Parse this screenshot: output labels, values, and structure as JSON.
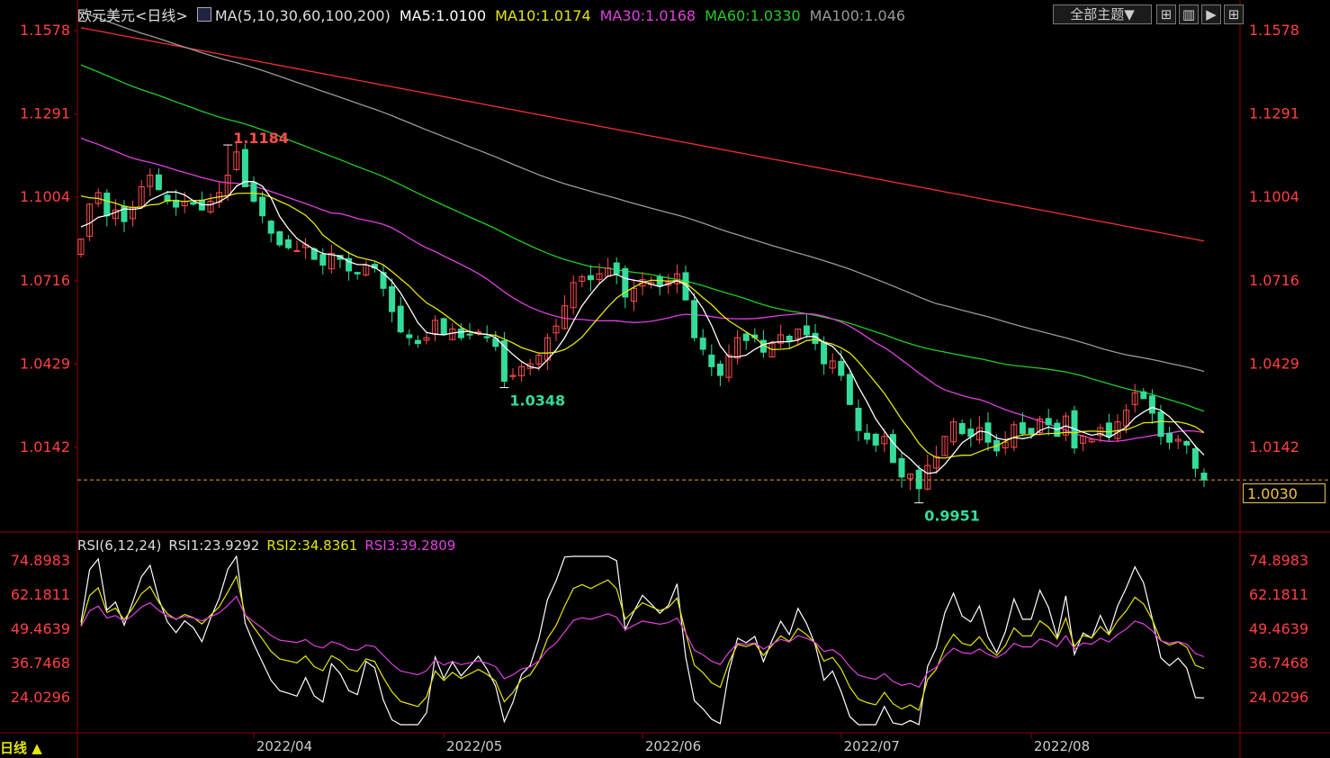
{
  "header": {
    "symbol": "欧元美元<日线>",
    "ma_label": "MA(5,10,30,60,100,200)",
    "ma5": "MA5:1.0100",
    "ma10": "MA10:1.0174",
    "ma30": "MA30:1.0168",
    "ma60": "MA60:1.0330",
    "ma100": "MA100:1.046"
  },
  "toolbar": {
    "theme_label": "全部主题▼",
    "btn1": "⊞",
    "btn2": "▥",
    "btn3": "▶",
    "btn4": "⊞"
  },
  "rsi_header": {
    "label": "RSI(6,12,24)",
    "rsi1": "RSI1:23.9292",
    "rsi2": "RSI2:34.8361",
    "rsi3": "RSI3:39.2809"
  },
  "current_price": "1.0030",
  "bottom_label": "日线 ▲",
  "colors": {
    "up": "#ff4d4d",
    "down": "#33dd99",
    "ma5": "#ffffff",
    "ma10": "#e6e600",
    "ma30": "#e040e0",
    "ma60": "#22cc22",
    "ma100": "#999999",
    "ma200": "#ee3030",
    "axis_text": "#ff4040",
    "grid": "#8b0000"
  },
  "chart_data": [
    {
      "type": "candlestick",
      "title": "欧元美元<日线>",
      "y_ticks": [
        "1.1578",
        "1.1291",
        "1.1004",
        "1.0716",
        "1.0429",
        "1.0142"
      ],
      "ylim": [
        0.9955,
        1.1578
      ],
      "x_ticks": [
        "2022/04",
        "2022/05",
        "2022/06",
        "2022/07",
        "2022/08"
      ],
      "annotations": [
        {
          "label": "1.1184",
          "value": 1.1184,
          "kind": "high"
        },
        {
          "label": "1.0348",
          "value": 1.0348,
          "kind": "low"
        },
        {
          "label": "0.9951",
          "value": 0.9951,
          "kind": "low"
        }
      ],
      "current_price_line": 1.003,
      "close": [
        1.086,
        1.098,
        1.102,
        1.094,
        1.096,
        1.092,
        1.097,
        1.104,
        1.108,
        1.103,
        1.099,
        1.097,
        1.099,
        1.098,
        1.096,
        1.099,
        1.102,
        1.108,
        1.116,
        1.104,
        1.099,
        1.094,
        1.088,
        1.084,
        1.083,
        1.082,
        1.084,
        1.079,
        1.077,
        1.081,
        1.079,
        1.075,
        1.074,
        1.077,
        1.076,
        1.069,
        1.061,
        1.054,
        1.052,
        1.05,
        1.052,
        1.058,
        1.053,
        1.055,
        1.052,
        1.053,
        1.054,
        1.052,
        1.049,
        1.037,
        1.039,
        1.042,
        1.043,
        1.046,
        1.052,
        1.056,
        1.063,
        1.071,
        1.073,
        1.072,
        1.074,
        1.076,
        1.074,
        1.066,
        1.069,
        1.072,
        1.071,
        1.07,
        1.071,
        1.074,
        1.065,
        1.052,
        1.048,
        1.042,
        1.039,
        1.046,
        1.052,
        1.051,
        1.052,
        1.047,
        1.05,
        1.053,
        1.051,
        1.055,
        1.053,
        1.05,
        1.043,
        1.044,
        1.039,
        1.029,
        1.02,
        1.017,
        1.015,
        1.018,
        1.009,
        1.004,
        1.005,
        1.0,
        1.008,
        1.011,
        1.018,
        1.023,
        1.019,
        1.018,
        1.021,
        1.016,
        1.013,
        1.016,
        1.022,
        1.019,
        1.019,
        1.024,
        1.022,
        1.018,
        1.025,
        1.014,
        1.018,
        1.017,
        1.021,
        1.018,
        1.023,
        1.027,
        1.033,
        1.031,
        1.026,
        1.018,
        1.016,
        1.017,
        1.015,
        1.007,
        1.003
      ],
      "ma_current": {
        "MA5": 1.01,
        "MA10": 1.0174,
        "MA30": 1.0168,
        "MA60": 1.033,
        "MA100": 1.046
      }
    },
    {
      "type": "line",
      "title": "RSI(6,12,24)",
      "y_ticks": [
        "74.8983",
        "62.1811",
        "49.4639",
        "36.7468",
        "24.0296"
      ],
      "ylim": [
        15,
        80
      ],
      "series": [
        {
          "name": "RSI1",
          "last": 23.9292
        },
        {
          "name": "RSI2",
          "last": 34.8361
        },
        {
          "name": "RSI3",
          "last": 39.2809
        }
      ]
    }
  ]
}
